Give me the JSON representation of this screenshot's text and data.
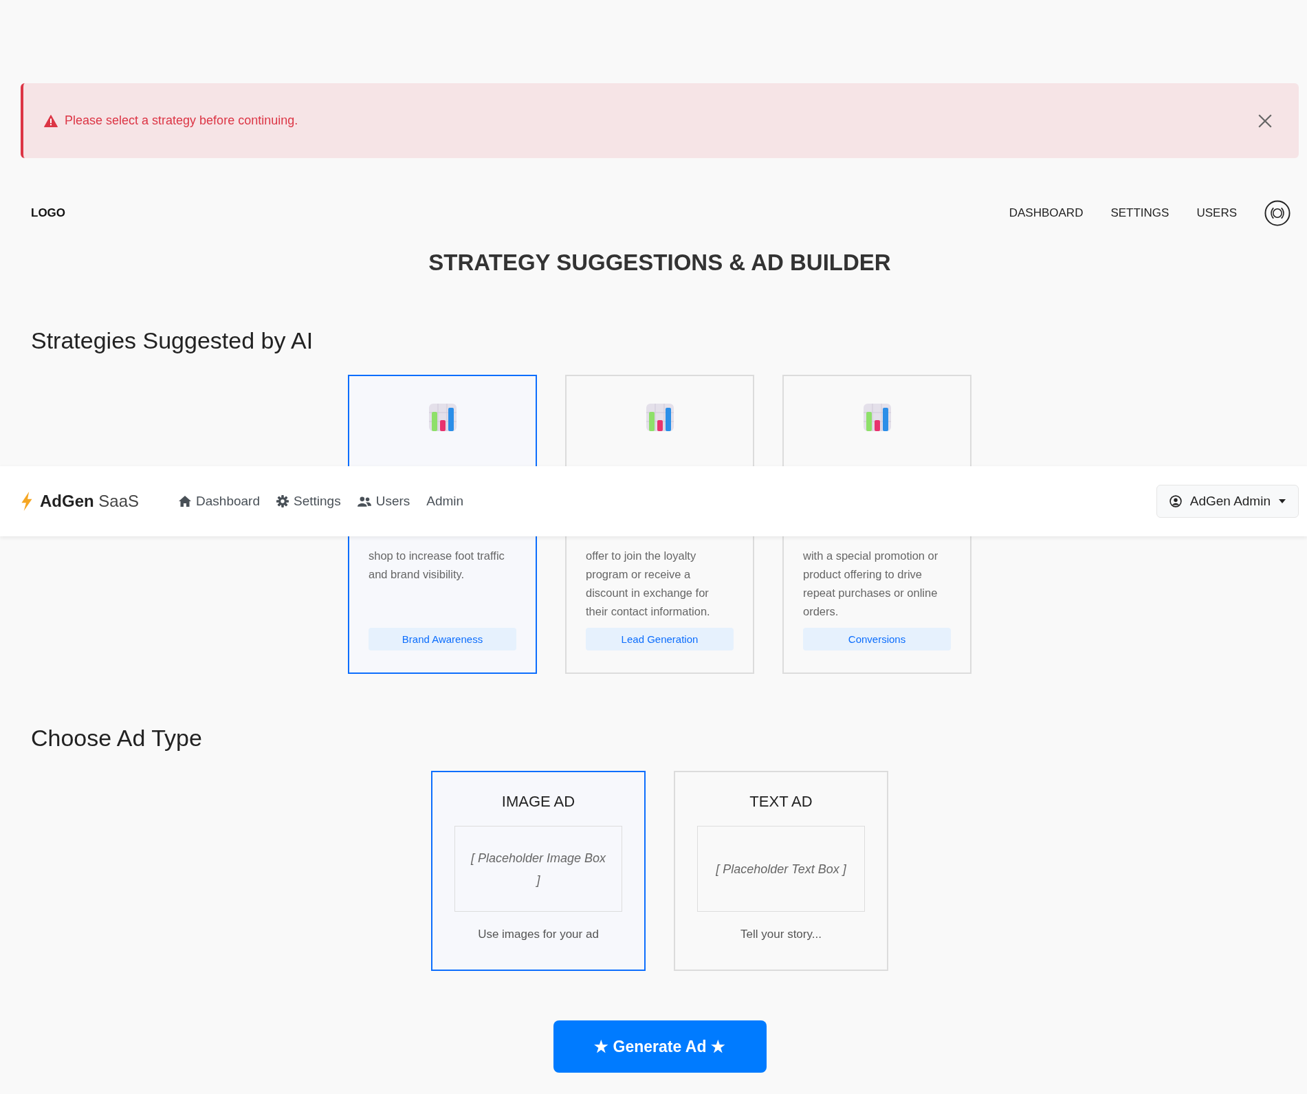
{
  "alert": {
    "message": "Please select a strategy before continuing."
  },
  "header": {
    "logo": "LOGO",
    "nav": [
      "DASHBOARD",
      "SETTINGS",
      "USERS"
    ]
  },
  "page_title": "STRATEGY SUGGESTIONS & AD BUILDER",
  "strategies": {
    "heading": "Strategies Suggested by AI",
    "cards": [
      {
        "description": "shop to increase foot traffic and brand visibility.",
        "tag": "Brand Awareness",
        "selected": true
      },
      {
        "description": "offer to join the loyalty program or receive a discount in exchange for their contact information.",
        "tag": "Lead Generation",
        "selected": false
      },
      {
        "description": "with a special promotion or product offering to drive repeat purchases or online orders.",
        "tag": "Conversions",
        "selected": false
      }
    ]
  },
  "navbar": {
    "brand": "AdGen",
    "brand_suffix": "SaaS",
    "items": [
      "Dashboard",
      "Settings",
      "Users",
      "Admin"
    ],
    "user_menu": "AdGen Admin"
  },
  "ad_types": {
    "heading": "Choose Ad Type",
    "cards": [
      {
        "title": "IMAGE AD",
        "placeholder_box": "[ Placeholder Image Box ]",
        "caption": "Use images for your ad",
        "selected": true
      },
      {
        "title": "TEXT AD",
        "placeholder_box": "[ Placeholder Text Box ]",
        "caption": "Tell your story...",
        "selected": false
      }
    ]
  },
  "generate_button": "★ Generate Ad ★"
}
